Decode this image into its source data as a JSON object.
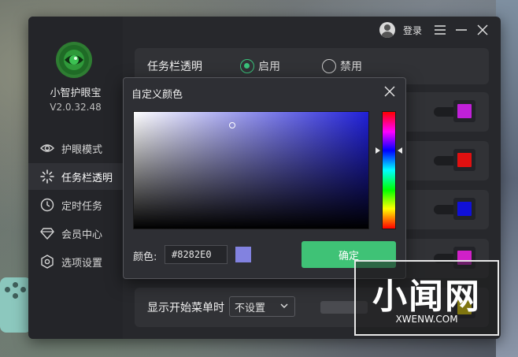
{
  "app": {
    "name": "小智护眼宝",
    "version": "V2.0.32.48",
    "login_label": "登录"
  },
  "sidebar": {
    "items": [
      {
        "label": "护眼模式",
        "icon": "eye-icon"
      },
      {
        "label": "任务栏透明",
        "icon": "sparkle-icon"
      },
      {
        "label": "定时任务",
        "icon": "clock-icon"
      },
      {
        "label": "会员中心",
        "icon": "diamond-icon"
      },
      {
        "label": "选项设置",
        "icon": "hexagon-settings-icon"
      }
    ],
    "active_index": 1
  },
  "main": {
    "taskbar_row": {
      "title": "任务栏透明",
      "options": [
        "启用",
        "禁用"
      ],
      "selected": "启用"
    },
    "color_swatches": [
      "#c020d8",
      "#e01010",
      "#1010d8",
      "#d020c8",
      "#f5e000"
    ],
    "start_menu_row": {
      "title": "显示开始菜单时",
      "select_value": "不设置"
    }
  },
  "dialog": {
    "title": "自定义颜色",
    "color_label": "颜色:",
    "hex_value": "#8282E0",
    "preview_color": "#8282E0",
    "ok_label": "确定"
  },
  "watermark": {
    "text": "小闻网",
    "sub": "XWENW.COM"
  },
  "colors": {
    "accent": "#3fc276",
    "window_bg": "#27282c"
  }
}
